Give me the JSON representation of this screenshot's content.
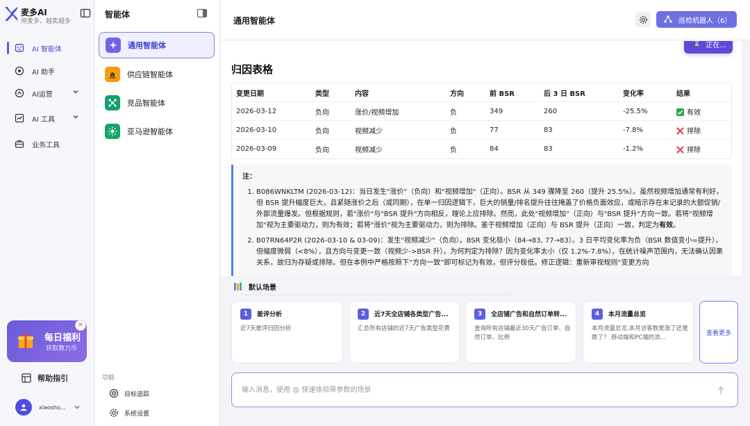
{
  "app": {
    "name": "麦多AI",
    "slogan": "用麦多，越卖越多"
  },
  "nav": {
    "items": [
      {
        "label": "AI 智能体",
        "active": true
      },
      {
        "label": "AI 助手"
      },
      {
        "label": "AI运营"
      },
      {
        "label": "AI 工具"
      },
      {
        "label": "业务工具"
      }
    ],
    "promo": {
      "title": "每日福利",
      "subtitle": "获取算力币",
      "close": "×"
    },
    "help": "帮助指引",
    "user": {
      "name": "xiaosho..."
    }
  },
  "agents": {
    "title": "智能体",
    "items": [
      {
        "label": "通用智能体",
        "active": true
      },
      {
        "label": "供应链智能体"
      },
      {
        "label": "竞品智能体"
      },
      {
        "label": "亚马逊智能体"
      }
    ],
    "function_label": "功能",
    "functions": [
      {
        "label": "目标追踪"
      },
      {
        "label": "系统设置"
      }
    ]
  },
  "header": {
    "title": "通用智能体",
    "patrol_button": "巡检机器人（6）",
    "running_button": "正在..."
  },
  "content": {
    "section_title": "归因表格",
    "table": {
      "columns": [
        "变更日期",
        "类型",
        "内容",
        "方向",
        "前 BSR",
        "后 3 日 BSR",
        "变化率",
        "结果"
      ],
      "rows": [
        {
          "date": "2026-03-12",
          "type": "负向",
          "content": "涨价/视频增加",
          "direction": "负",
          "before": "349",
          "after": "260",
          "rate": "-25.5%",
          "result": "有效",
          "result_kind": "ok"
        },
        {
          "date": "2026-03-10",
          "type": "负向",
          "content": "视频减少",
          "direction": "负",
          "before": "77",
          "after": "83",
          "rate": "-7.8%",
          "result": "排除",
          "result_kind": "x"
        },
        {
          "date": "2026-03-09",
          "type": "负向",
          "content": "视频减少",
          "direction": "负",
          "before": "84",
          "after": "83",
          "rate": "-1.2%",
          "result": "排除",
          "result_kind": "x"
        }
      ]
    },
    "note": {
      "title": "注：",
      "item1_main": "B086WNKLTM (2026-03-12)：当日发生\"涨价\"（负向）和\"视频增加\"（正向）。BSR 从 349 骤降至 260（提升 25.5%）。虽然视频增加通常有利好，但 BSR 提升幅度巨大，且紧随涨价之后（或同期），在单一归因逻辑下，巨大的销量/排名提升往往掩盖了价格负面效应，或暗示存在未记录的大额促销/外部流量爆发。但根据规则，若\"涨价\"与\"BSR 提升\"方向相反，理论上应排除。然而，此处\"视频增加\"（正向）与\"BSR 提升\"方向一致。若将\"视频增加\"视为主要驱动力，则为有效；若将\"涨价\"视为主要驱动力，则为排除。鉴于视频增加（正向）与 BSR 提升（正向）一致，判定为",
      "item1_bold": "有效",
      "item1_end": "。",
      "item2": "B07RN64P2R (2026-03-10 & 03-09)：发生\"视频减少\"（负向）。BSR 变化极小（84→83, 77→83）。3 日平均变化率为负（BSR 数值变小=提升），但幅度微弱（<8%），且方向与变更一致（视频少->BSR 升）。为何判定为排除？因为变化率太小（仅 1.2%-7.8%），在统计噪声范围内，无法确认因果关系，故归为存疑或排除。但在本例中严格按照下“方向一致”即可标记为有效，但评分极低。修正逻辑：重新审视规则“变更方向"
    }
  },
  "scenarios": {
    "title": "默认场景",
    "cards": [
      {
        "num": "1",
        "title": "差评分析",
        "desc": "近7天差评归因分析"
      },
      {
        "num": "2",
        "title": "近7天全店铺各类型广告...",
        "desc": "汇总所有店铺的近7天广告类型花费"
      },
      {
        "num": "3",
        "title": "全店铺广告和自然订单转...",
        "desc": "查询所有店铺最近30天广告订单、自然订单、比例"
      },
      {
        "num": "4",
        "title": "本月流量总览",
        "desc": "本月流量总览,本月访客数是涨了还是跌了？.移动端和PC端的流..."
      }
    ],
    "more": "查看更多"
  },
  "input": {
    "placeholder": "输入消息，使用 @ 快速体验带参数的场景",
    "value": ""
  },
  "colors": {
    "accent": "#5b5fe0",
    "note_border": "#4f7fe6",
    "ok": "#2ba84a",
    "x": "#e0445a"
  }
}
